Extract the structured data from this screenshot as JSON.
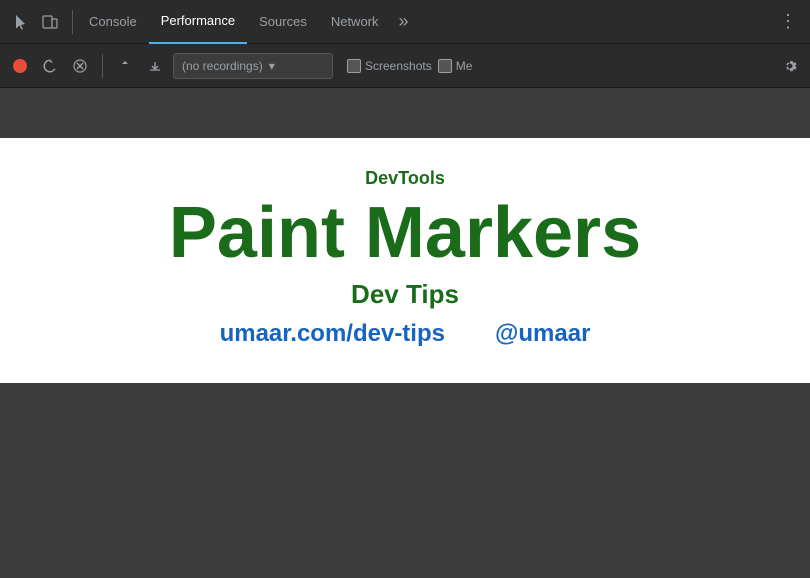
{
  "devtools": {
    "tabs": [
      {
        "id": "console",
        "label": "Console",
        "active": false
      },
      {
        "id": "performance",
        "label": "Performance",
        "active": true
      },
      {
        "id": "sources",
        "label": "Sources",
        "active": false
      },
      {
        "id": "network",
        "label": "Network",
        "active": false
      }
    ],
    "more_button": "»",
    "menu_button": "⋮",
    "recording": {
      "no_recordings": "(no recordings)",
      "screenshots_label": "Screenshots",
      "memory_label": "Me"
    }
  },
  "content": {
    "devtools_label": "DevTools",
    "title": "Paint Markers",
    "subtitle": "Dev Tips",
    "link1": "umaar.com/dev-tips",
    "link2": "@umaar"
  }
}
